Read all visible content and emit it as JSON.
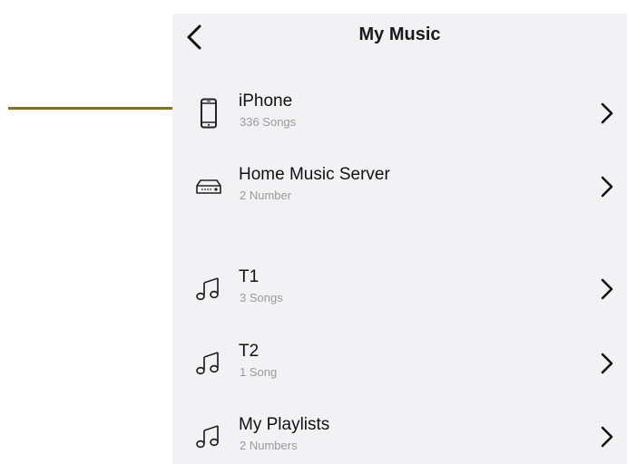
{
  "header": {
    "title": "My Music",
    "back_icon": "chevron-left-icon"
  },
  "sources": [
    {
      "name": "iPhone",
      "detail": "336 Songs",
      "icon": "phone-icon"
    },
    {
      "name": "Home Music Server",
      "detail": "2 Number",
      "icon": "media-server-icon"
    }
  ],
  "playlists": [
    {
      "name": "T1",
      "detail": "3 Songs",
      "icon": "music-note-icon"
    },
    {
      "name": "T2",
      "detail": "1 Song",
      "icon": "music-note-icon"
    },
    {
      "name": "My Playlists",
      "detail": "2 Numbers",
      "icon": "music-note-icon"
    }
  ],
  "colors": {
    "panel_background": "#f2f2f4",
    "callout_line": "#8a6d1f",
    "subtitle_text": "#9a9a9e"
  }
}
